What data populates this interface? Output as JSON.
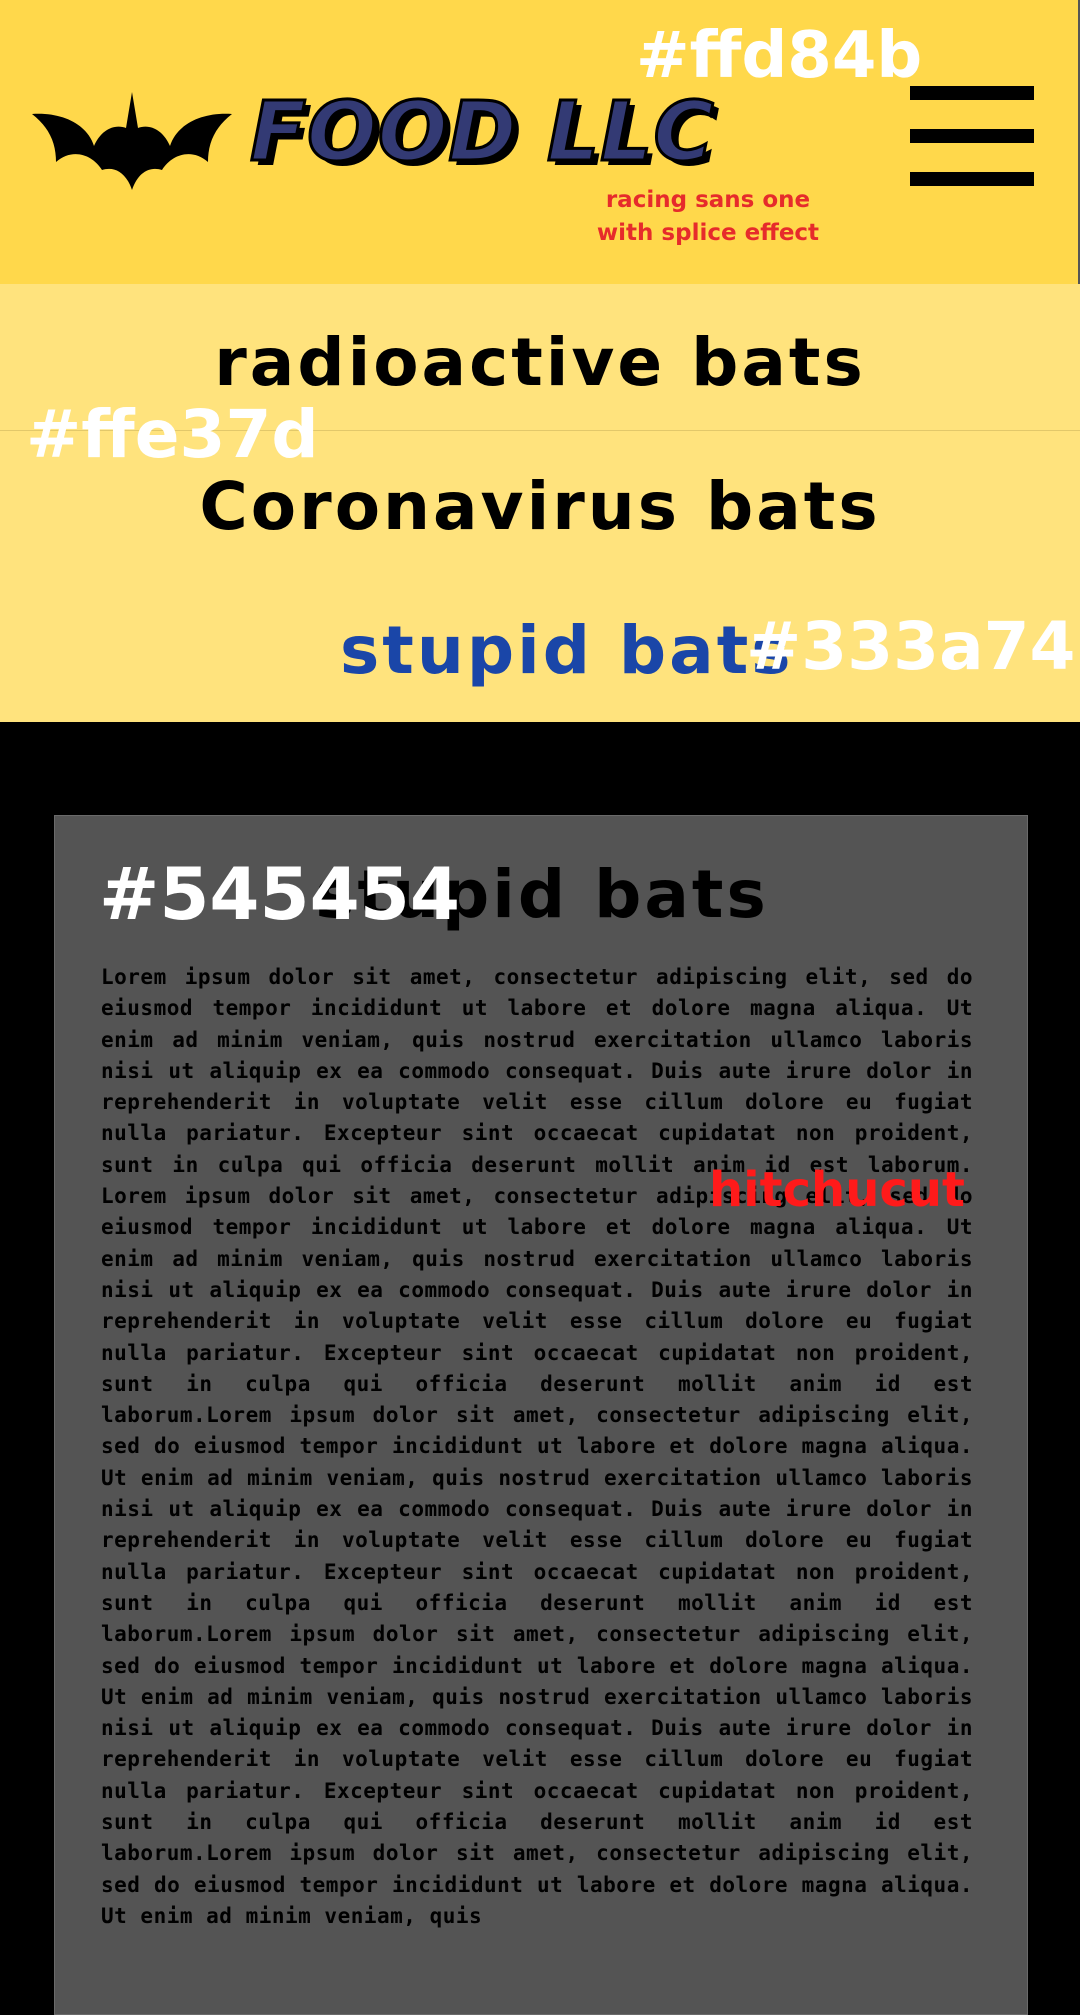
{
  "header": {
    "brand": "FOOD LLC",
    "font_note": "racing sans one with splice effect",
    "swatch": "#ffd84b",
    "background": "#ffd84b",
    "logo_icon": "bat-icon",
    "menu_icon": "hamburger-menu-icon"
  },
  "nav": {
    "background": "#ffe37d",
    "swatch": "#ffe37d",
    "items": [
      {
        "label": "radioactive bats"
      },
      {
        "label": "Coronavirus bats"
      },
      {
        "label": "stupid bats"
      }
    ],
    "highlight_swatch": "#333a74",
    "highlight_color": "#1a46a8"
  },
  "content": {
    "background": "#545454",
    "swatch": "#545454",
    "title": "stupid bats",
    "font_note": "hitchucut",
    "body": "Lorem ipsum dolor sit amet, consectetur adipiscing elit, sed do eiusmod tempor incididunt ut labore et dolore magna aliqua. Ut enim ad minim veniam, quis nostrud exercitation ullamco laboris nisi ut aliquip ex ea commodo consequat. Duis aute irure dolor in reprehenderit in voluptate velit esse cillum dolore eu fugiat nulla pariatur. Excepteur sint occaecat cupidatat non proident, sunt in culpa qui officia deserunt mollit anim id est laborum. Lorem ipsum dolor sit amet, consectetur adipiscing elit, sed do eiusmod tempor incididunt ut labore et dolore magna aliqua. Ut enim ad minim veniam, quis nostrud exercitation ullamco laboris nisi ut aliquip ex ea commodo consequat. Duis aute irure dolor in reprehenderit in voluptate velit esse cillum dolore eu fugiat nulla pariatur. Excepteur sint occaecat cupidatat non proident, sunt in culpa qui officia deserunt mollit anim id est laborum.Lorem ipsum dolor sit amet, consectetur adipiscing elit, sed do eiusmod tempor incididunt ut labore et dolore magna aliqua. Ut enim ad minim veniam, quis nostrud exercitation ullamco laboris nisi ut aliquip ex ea commodo consequat. Duis aute irure dolor in reprehenderit in voluptate velit esse cillum dolore eu fugiat nulla pariatur. Excepteur sint occaecat cupidatat non proident, sunt in culpa qui officia deserunt mollit anim id est laborum.Lorem ipsum dolor sit amet, consectetur adipiscing elit, sed do eiusmod tempor incididunt ut labore et dolore magna aliqua. Ut enim ad minim veniam, quis nostrud exercitation ullamco laboris nisi ut aliquip ex ea commodo consequat. Duis aute irure dolor in reprehenderit in voluptate velit esse cillum dolore eu fugiat nulla pariatur. Excepteur sint occaecat cupidatat non proident, sunt in culpa qui officia deserunt mollit anim id est laborum.Lorem ipsum dolor sit amet, consectetur adipiscing elit, sed do eiusmod tempor incididunt ut labore et dolore magna aliqua. Ut enim ad minim veniam, quis"
  }
}
